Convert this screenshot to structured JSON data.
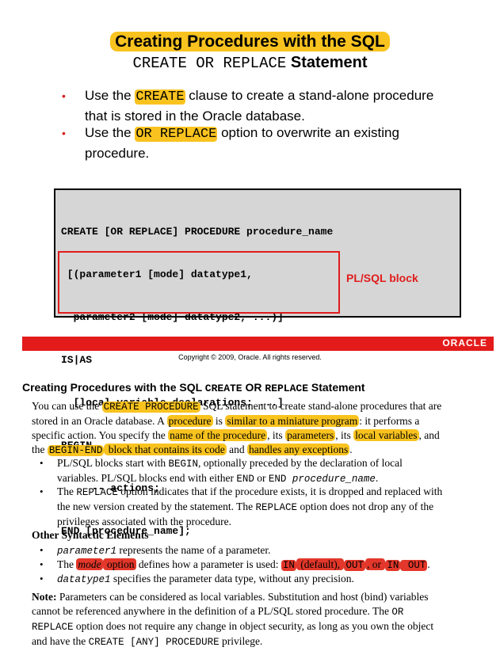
{
  "slide": {
    "title_line1": "Creating Procedures with the SQL",
    "title_line2_code": "CREATE OR REPLACE",
    "title_line2_rest": " Statement",
    "bullets": [
      {
        "pre": "Use the ",
        "code": "CREATE",
        "post": " clause to create a stand-alone procedure",
        "line2": "that is stored in the Oracle database."
      },
      {
        "pre": "Use the ",
        "code": "OR REPLACE",
        "post": " option to overwrite an existing",
        "line2": "procedure."
      }
    ],
    "code_lines": [
      "CREATE [OR REPLACE] PROCEDURE procedure_name",
      " [(parameter1 [mode] datatype1,",
      "  parameter2 [mode] datatype2, ...)]",
      "IS|AS",
      "  [local_variable_declarations; ...]",
      "BEGIN",
      "     -- actions;",
      "END [procedure_name];"
    ],
    "plsql_label": "PL/SQL block",
    "oracle_logo": "ORACLE",
    "copyright": "Copyright © 2009, Oracle. All rights reserved."
  },
  "notes": {
    "heading_pre": "Creating Procedures with the SQL ",
    "heading_code1": "CREATE",
    "heading_mid": " OR ",
    "heading_code2": "REPLACE",
    "heading_post": " Statement",
    "para1": {
      "l1_a": "You can use the ",
      "l1_hl": "CREATE PROCEDURE",
      "l1_b": " SQL statement to create stand-alone procedures that are",
      "l2_a": "stored in an Oracle database. A ",
      "l2_hl1": "procedure",
      "l2_b": " is ",
      "l2_hl2": "similar to a miniature program",
      "l2_c": ": it performs a",
      "l3_a": "specific action. You specify the ",
      "l3_hl1": "name of the procedure",
      "l3_b": ", its ",
      "l3_hl2": "parameters",
      "l3_c": ", its ",
      "l3_hl3": "local variables",
      "l3_d": ", and",
      "l4_a": "the ",
      "l4_hl1": "BEGIN-END",
      "l4_hl2": " block that contains its code",
      "l4_b": " and ",
      "l4_hl3": "handles any exceptions",
      "l4_c": "."
    },
    "bullet1": {
      "l1_a": "PL/SQL blocks start with ",
      "l1_code": "BEGIN",
      "l1_b": ", optionally preceded by the declaration of local",
      "l2_a": "variables. PL/SQL blocks end with either ",
      "l2_code1": "END",
      "l2_b": " or ",
      "l2_code2": "END",
      "l2_code3": " procedure_name",
      "l2_c": "."
    },
    "bullet2": {
      "l1_a": "The ",
      "l1_code": "REPLACE",
      "l1_b": " option indicates that if the procedure exists, it is dropped and replaced with",
      "l2_a": "the new version created by the statement. The ",
      "l2_code": "REPLACE",
      "l2_b": " option does not drop any of the",
      "l3": "privileges associated with the procedure."
    },
    "other_heading": "Other Syntactic Elements",
    "other1": {
      "code": "parameter1",
      "text": " represents the name of a parameter."
    },
    "other2": {
      "a": "The ",
      "hl1": "mode",
      "hl2": " option",
      "b": " defines how a parameter is used: ",
      "in": "IN",
      "c": " (default), ",
      "out": "OUT",
      "d": ", or ",
      "inout1": "IN",
      "inout2": " OUT",
      "e": "."
    },
    "other3": {
      "code": "datatype1",
      "text": " specifies the parameter data type, without any precision."
    },
    "note": {
      "label": "Note:",
      "l1": " Parameters can be considered as local variables. Substitution and host (bind) variables",
      "l2_a": "cannot be referenced anywhere in the definition of a PL/SQL stored procedure. The ",
      "l2_code": "OR",
      "l3_code": "REPLACE",
      "l3_b": " option does not require any change in object security, as long as you own the object",
      "l4_a": "and have the ",
      "l4_code": "CREATE [ANY] PROCEDURE",
      "l4_b": " privilege."
    },
    "bullet_glyph": "•",
    "slide_bullet_glyph": "•"
  },
  "colors": {
    "highlight": "#f9c31f",
    "red_highlight": "#e2372a",
    "oracle_red": "#e31b1b"
  }
}
